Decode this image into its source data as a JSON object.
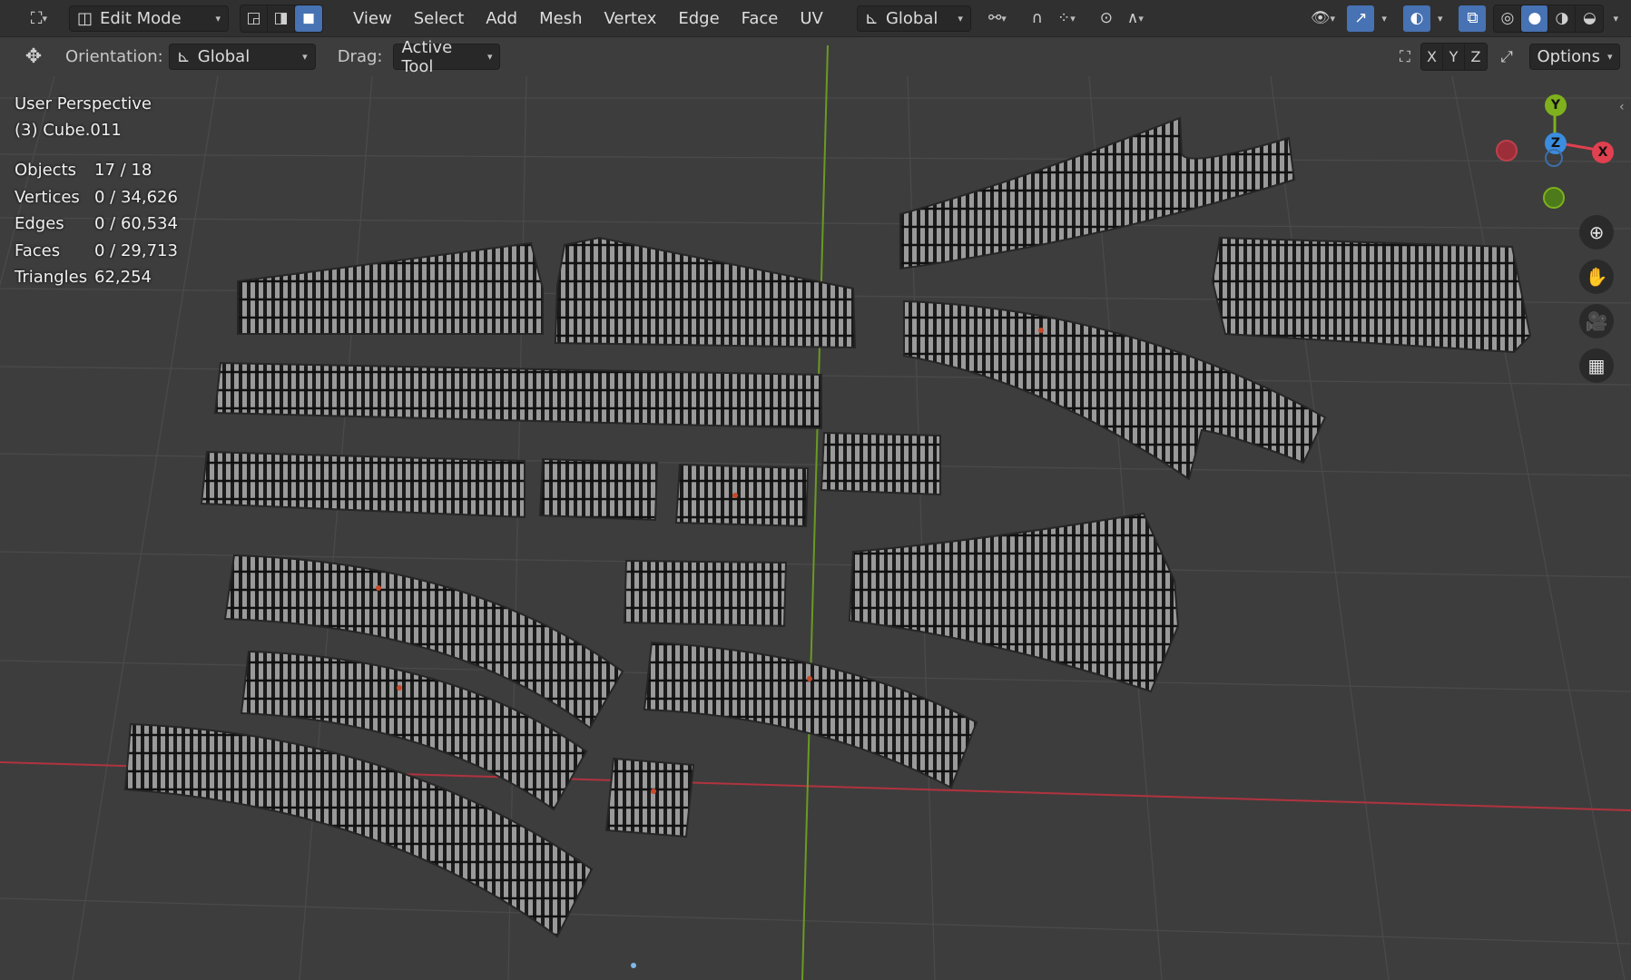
{
  "header": {
    "mode_label": "Edit Mode",
    "menus": [
      "View",
      "Select",
      "Add",
      "Mesh",
      "Vertex",
      "Edge",
      "Face",
      "UV"
    ],
    "transform_orientation": "Global"
  },
  "toolbar": {
    "orientation_label": "Orientation:",
    "orientation_value": "Global",
    "drag_label": "Drag:",
    "drag_value": "Active Tool",
    "axis_x": "X",
    "axis_y": "Y",
    "axis_z": "Z",
    "options_label": "Options"
  },
  "viewport": {
    "view_name": "User Perspective",
    "object_name": "(3) Cube.011",
    "stats": [
      {
        "key": "Objects",
        "value": "17 / 18"
      },
      {
        "key": "Vertices",
        "value": "0 / 34,626"
      },
      {
        "key": "Edges",
        "value": "0 / 60,534"
      },
      {
        "key": "Faces",
        "value": "0 / 29,713"
      },
      {
        "key": "Triangles",
        "value": "62,254"
      }
    ]
  },
  "gizmo": {
    "y_label": "Y",
    "z_label": "Z",
    "x_label": "X",
    "colors": {
      "x": "#e0404f",
      "y": "#7fb01e",
      "z": "#3b8de0",
      "neg_x": "#9c2e3a",
      "neg_y": "#4d7a1a"
    }
  },
  "colors": {
    "header_bg": "#303030",
    "viewport_bg": "#3d3d3d",
    "accent": "#4772b3",
    "x_axis_line": "#b0333f",
    "y_axis_line": "#6a9a22"
  }
}
